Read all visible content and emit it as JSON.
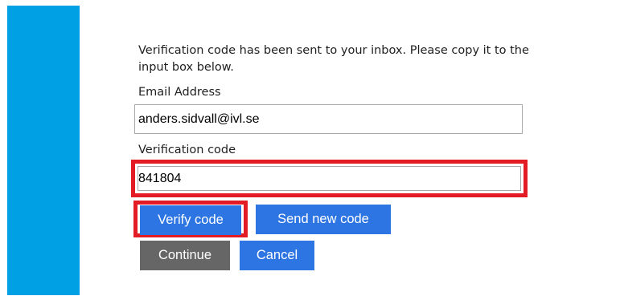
{
  "sidebar": {
    "color": "#00a1e4"
  },
  "form": {
    "intro_text": "Verification code has been sent to your inbox. Please copy it to the input box below.",
    "email": {
      "label": "Email Address",
      "value": "anders.sidvall@ivl.se"
    },
    "verification": {
      "label": "Verification code",
      "value": "841804"
    },
    "buttons": {
      "verify": "Verify code",
      "send_new": "Send new code",
      "continue": "Continue",
      "cancel": "Cancel"
    }
  },
  "colors": {
    "primary_button": "#2d75e3",
    "secondary_button": "#666666",
    "highlight": "#e31b24"
  }
}
